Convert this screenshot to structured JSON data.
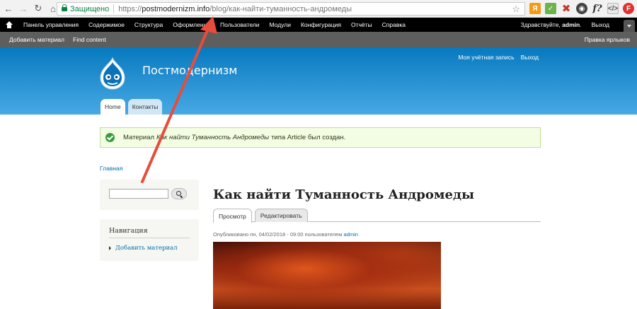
{
  "browser": {
    "secure_label": "Защищено",
    "url_scheme": "https://",
    "url_host": "postmodernizm.info",
    "url_path": "/blog/как-найти-туманность-андромеды",
    "extensions": [
      "ya-icon",
      "green-icon",
      "close-icon",
      "pocket-icon",
      "f?",
      "</>",
      "ff-icon"
    ]
  },
  "toolbar": {
    "items": [
      "Панель управления",
      "Содержимое",
      "Структура",
      "Оформление",
      "Пользователи",
      "Модули",
      "Конфигурация",
      "Отчёты",
      "Справка"
    ],
    "greeting_prefix": "Здравствуйте, ",
    "greeting_user": "admin",
    "logout": "Выход"
  },
  "shortcuts": {
    "items": [
      "Добавить материал",
      "Find content"
    ],
    "edit_shortcuts": "Правка ярлыков"
  },
  "header": {
    "site_name": "Постмодернизм",
    "secondary_menu": [
      "Моя учётная запись",
      "Выход"
    ],
    "main_menu": [
      "Home",
      "Контакты"
    ]
  },
  "message": {
    "prefix": "Материал",
    "title": "Как найти Туманность Андромеды",
    "suffix": "типа Article был создан."
  },
  "breadcrumb": "Главная",
  "sidebar": {
    "search_placeholder": "",
    "nav_title": "Навигация",
    "nav_links": [
      "Добавить материал"
    ]
  },
  "node": {
    "title": "Как найти Туманность Андромеды",
    "tabs": [
      "Просмотр",
      "Редактировать"
    ],
    "submitted_prefix": "Опубликовано пн, 04/02/2018 - 09:00 пользователем",
    "author": "admin"
  },
  "colors": {
    "header_top": "#0779bf",
    "header_bottom": "#48a9e4",
    "link": "#0071b3",
    "message_bg": "#f3fde4",
    "arrow": "#e74c3c"
  }
}
